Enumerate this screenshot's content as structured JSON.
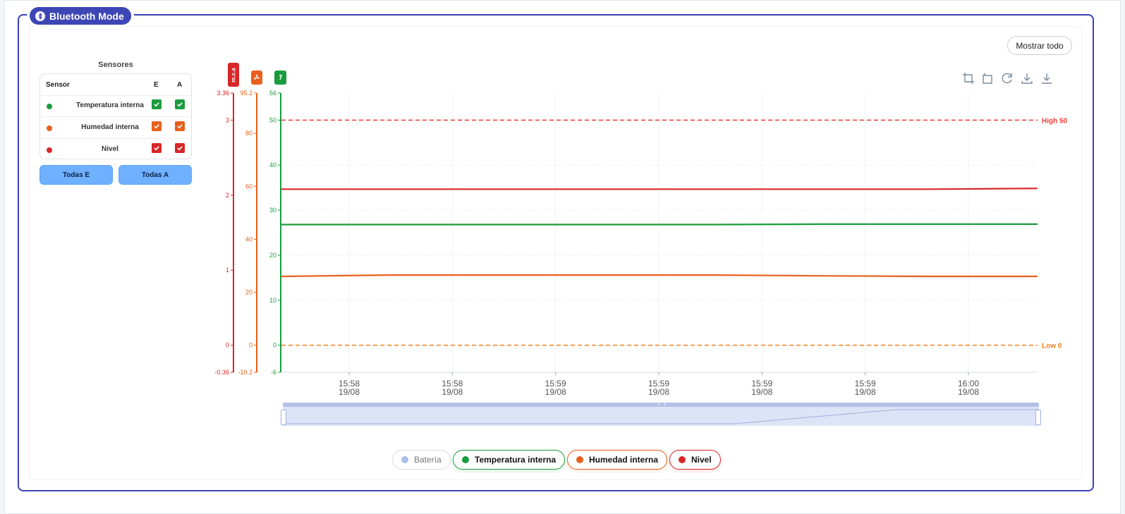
{
  "panel": {
    "title": "Bluetooth Mode"
  },
  "actions": {
    "show_all": "Mostrar todo"
  },
  "sensors": {
    "title": "Sensores",
    "headers": {
      "sensor": "Sensor",
      "e": "E",
      "a": "A"
    },
    "rows": [
      {
        "name": "Temperatura interna",
        "color": "#1a9c3e",
        "e": true,
        "a": true
      },
      {
        "name": "Humedad interna",
        "color": "#e8601c",
        "e": true,
        "a": true
      },
      {
        "name": "Nivel",
        "color": "#d62728",
        "e": true,
        "a": true
      }
    ],
    "buttons": {
      "all_e": "Todas E",
      "all_a": "Todas A"
    }
  },
  "axes_tags": [
    {
      "name": "nivel-axis-tag",
      "label": "m.c.a",
      "color": "#d62728"
    },
    {
      "name": "humidity-axis-tag",
      "icon": "fan-icon",
      "color": "#e8601c"
    },
    {
      "name": "temperature-axis-tag",
      "icon": "thermometer-icon",
      "color": "#1a9c3e"
    }
  ],
  "toolbox": [
    "zoom-icon",
    "zoom-reset-icon",
    "refresh-icon",
    "download-icon",
    "download-alt-icon"
  ],
  "legend": [
    {
      "label": "Batería",
      "color": "#a9bde8",
      "active": false
    },
    {
      "label": "Temperatura interna",
      "color": "#1a9c3e",
      "active": true
    },
    {
      "label": "Humedad interna",
      "color": "#e8601c",
      "active": true
    },
    {
      "label": "Nivel",
      "color": "#d62728",
      "active": true
    }
  ],
  "chart_data": {
    "type": "line",
    "x_ticks": [
      {
        "time": "15:58",
        "date": "19/08"
      },
      {
        "time": "15:58",
        "date": "19/08"
      },
      {
        "time": "15:59",
        "date": "19/08"
      },
      {
        "time": "15:59",
        "date": "19/08"
      },
      {
        "time": "15:59",
        "date": "19/08"
      },
      {
        "time": "15:59",
        "date": "19/08"
      },
      {
        "time": "16:00",
        "date": "19/08"
      }
    ],
    "axes": [
      {
        "id": "nivel",
        "color": "#d62728",
        "min": -0.36,
        "max": 3.36,
        "ticks": [
          "3.36",
          "3",
          "2",
          "1",
          "0",
          "-0.36"
        ],
        "tick_values": [
          3.36,
          3,
          2,
          1,
          0,
          -0.36
        ]
      },
      {
        "id": "humedad",
        "color": "#e8601c",
        "min": -10.2,
        "max": 95.2,
        "ticks": [
          "95.2",
          "80",
          "60",
          "40",
          "20",
          "0",
          "-10.2"
        ],
        "tick_values": [
          95.2,
          80,
          60,
          40,
          20,
          0,
          -10.2
        ]
      },
      {
        "id": "temperatura",
        "color": "#1a9c3e",
        "min": -6,
        "max": 56,
        "ticks": [
          "56",
          "50",
          "40",
          "30",
          "20",
          "10",
          "0",
          "-6"
        ],
        "tick_values": [
          56,
          50,
          40,
          30,
          20,
          10,
          0,
          -6
        ]
      }
    ],
    "series": [
      {
        "name": "Nivel",
        "axis": "nivel",
        "color": "#d62728",
        "values": [
          2.08,
          2.08,
          2.08,
          2.08,
          2.08,
          2.08,
          2.08,
          2.09
        ]
      },
      {
        "name": "Temperatura interna",
        "axis": "temperatura",
        "color": "#1a9c3e",
        "values": [
          26.8,
          26.8,
          26.8,
          26.8,
          26.8,
          26.9,
          26.9,
          26.9
        ]
      },
      {
        "name": "Humedad interna",
        "axis": "humedad",
        "color": "#e8601c",
        "values": [
          26.0,
          26.5,
          26.5,
          26.5,
          26.5,
          26.2,
          26.0,
          26.0
        ]
      }
    ],
    "mark_lines": [
      {
        "label": "High 50",
        "axis": "temperatura",
        "value": 50,
        "color": "#f03a3a"
      },
      {
        "label": "Low 0",
        "axis": "temperatura",
        "value": 0,
        "color": "#f0801f"
      }
    ]
  }
}
